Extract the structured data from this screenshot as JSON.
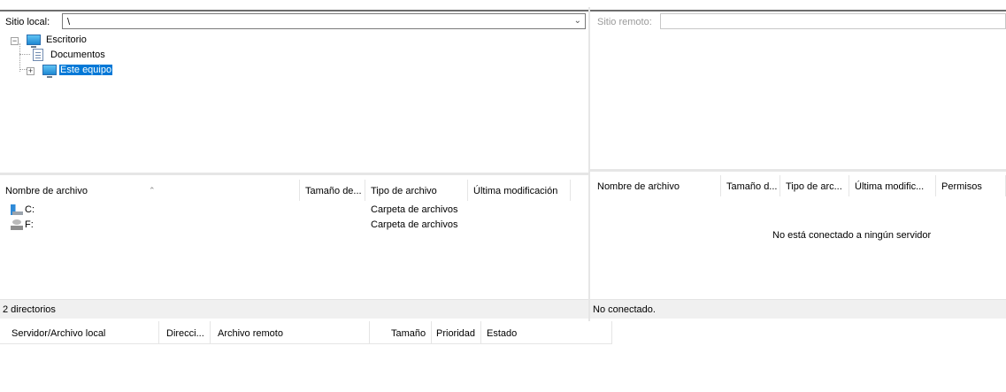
{
  "local": {
    "site_label": "Sitio local:",
    "path": "\\",
    "tree": [
      {
        "label": "Escritorio",
        "icon": "desktop-icon"
      },
      {
        "label": "Documentos",
        "icon": "documents-icon"
      },
      {
        "label": "Este equipo",
        "icon": "computer-icon",
        "selected": true
      }
    ],
    "columns": [
      "Nombre de archivo",
      "Tamaño de...",
      "Tipo de archivo",
      "Última modificación"
    ],
    "files": [
      {
        "name": "C:",
        "type": "Carpeta de archivos",
        "icon": "drive-c-icon"
      },
      {
        "name": "F:",
        "type": "Carpeta de archivos",
        "icon": "drive-f-icon"
      }
    ],
    "status": "2 directorios"
  },
  "remote": {
    "site_label": "Sitio remoto:",
    "path": "",
    "columns": [
      "Nombre de archivo",
      "Tamaño d...",
      "Tipo de arc...",
      "Última modific...",
      "Permisos"
    ],
    "empty_message": "No está conectado a ningún servidor",
    "status": "No conectado."
  },
  "queue": {
    "columns": [
      "Servidor/Archivo local",
      "Direcci...",
      "Archivo remoto",
      "Tamaño",
      "Prioridad",
      "Estado"
    ]
  },
  "colors": {
    "selection": "#0078d7",
    "status_bar": "#f0f0f0",
    "disabled_text": "#9a9a9a"
  }
}
